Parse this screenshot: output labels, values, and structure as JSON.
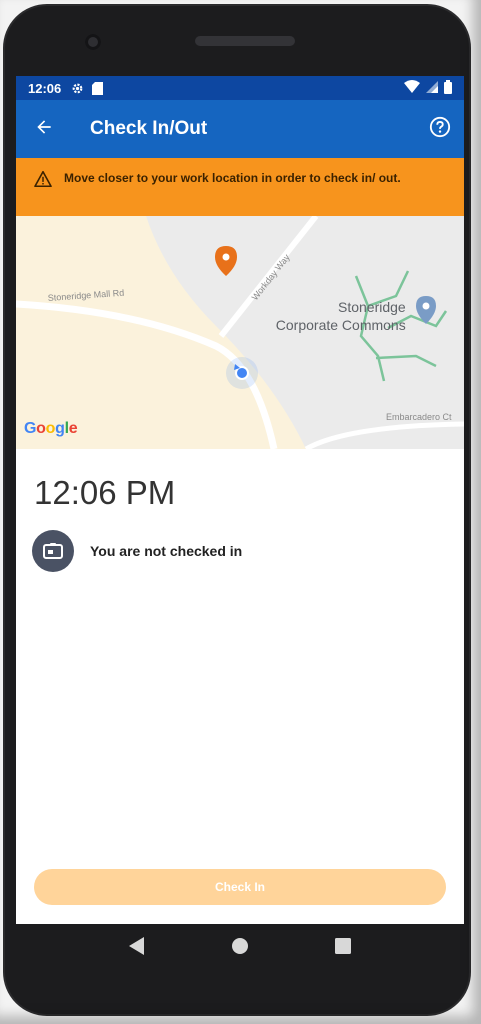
{
  "status_bar": {
    "time": "12:06",
    "icons": [
      "settings-icon",
      "sd-card-icon",
      "wifi-icon",
      "signal-icon",
      "battery-icon"
    ]
  },
  "app_bar": {
    "title": "Check In/Out",
    "back_icon": "arrow-back-icon",
    "help_icon": "help-circle-icon"
  },
  "warning_banner": {
    "icon": "warning-triangle-icon",
    "text": "Move closer to your work location in order to check in/ out."
  },
  "map": {
    "logo": "Google",
    "poi_label_line1": "Stoneridge",
    "poi_label_line2": "Corporate Commons",
    "road_labels": [
      "Stoneridge Mall Rd",
      "Workday Way",
      "Embarcadero Ct"
    ]
  },
  "clock": {
    "time": "12:06 PM"
  },
  "check_status": {
    "icon": "badge-icon",
    "text": "You are not checked in"
  },
  "actions": {
    "check_in_label": "Check In"
  },
  "colors": {
    "status_bar": "#0d47a1",
    "app_bar": "#1565c0",
    "warning": "#f7941d",
    "button_disabled": "#ffd49a",
    "location_pin": "#e8711a",
    "user_dot": "#4285f4"
  },
  "nav_bar": {
    "icons": [
      "back-triangle-icon",
      "home-circle-icon",
      "recents-square-icon"
    ]
  }
}
